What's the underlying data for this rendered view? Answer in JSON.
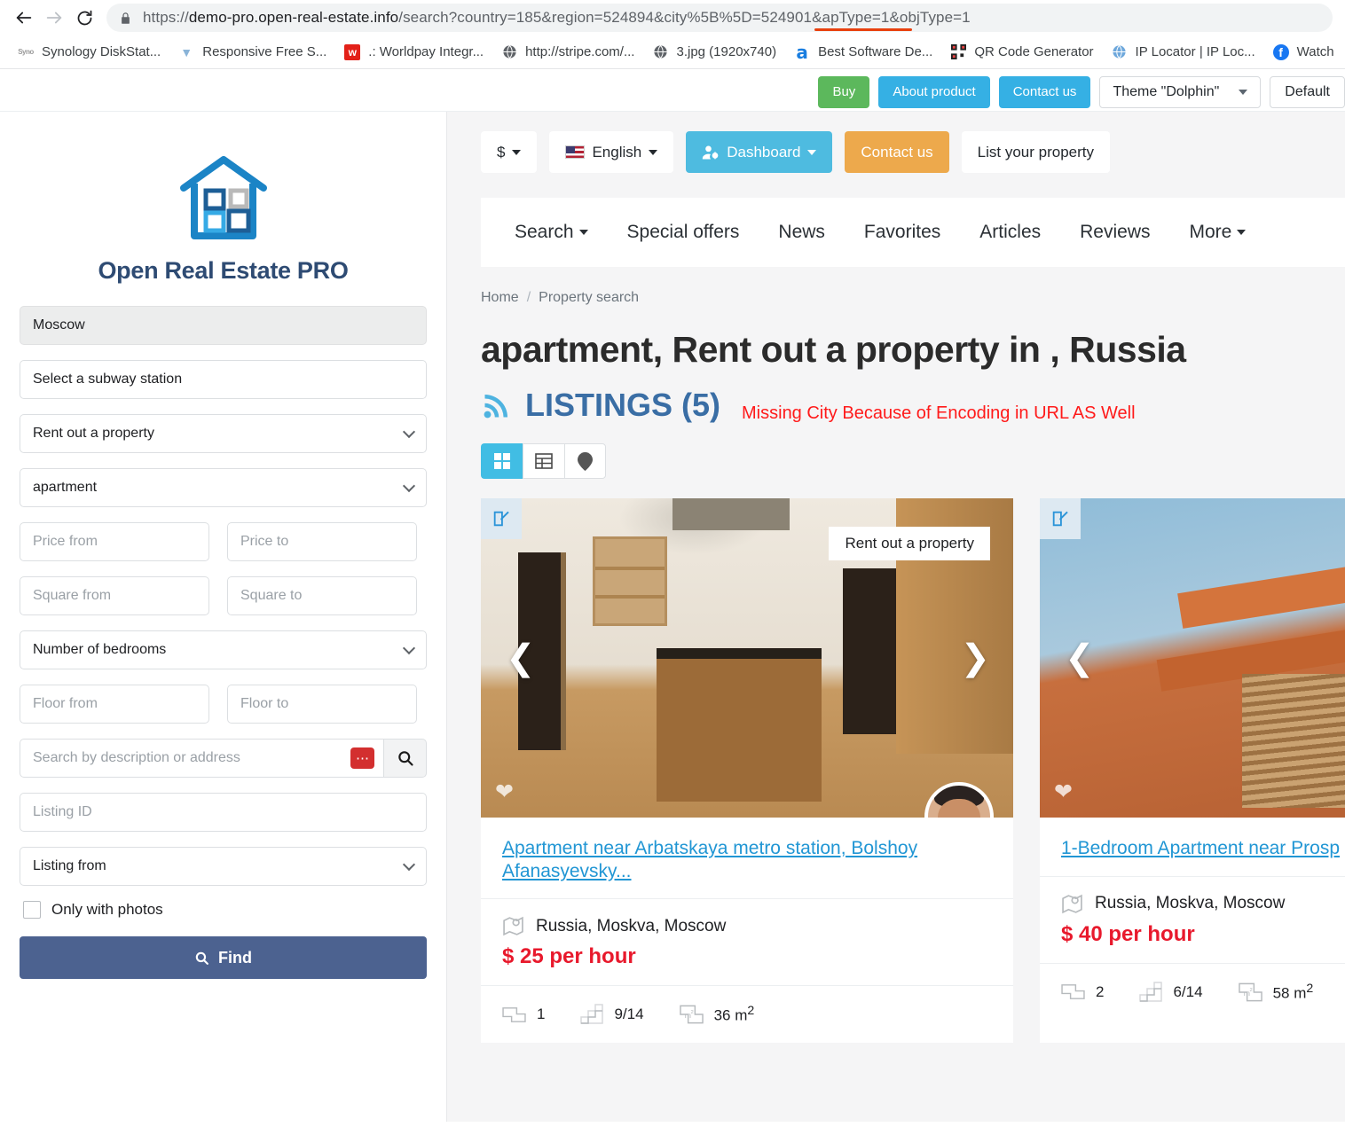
{
  "browser": {
    "url_prefix": "https://",
    "url_host": "demo-pro.open-real-estate.info",
    "url_path": "/search?country=185&region=524894&city%5B%5D=524901&apType=1&objType=1",
    "bookmarks": [
      {
        "label": "Synology DiskStat...",
        "icon": "syno-icon"
      },
      {
        "label": "Responsive Free S...",
        "icon": "responsive-icon"
      },
      {
        "label": ".: Worldpay Integr...",
        "icon": "worldpay-icon"
      },
      {
        "label": "http://stripe.com/...",
        "icon": "globe-icon"
      },
      {
        "label": "3.jpg (1920x740)",
        "icon": "globe-icon"
      },
      {
        "label": "Best Software De...",
        "icon": "amazon-icon"
      },
      {
        "label": "QR Code Generator",
        "icon": "qr-icon"
      },
      {
        "label": "IP Locator | IP Loc...",
        "icon": "globe-icon"
      },
      {
        "label": "Watch",
        "icon": "facebook-icon"
      }
    ]
  },
  "demo_bar": {
    "buy": "Buy",
    "about": "About product",
    "contact": "Contact us",
    "theme": "Theme \"Dolphin\"",
    "default": "Default"
  },
  "sidebar": {
    "brand": "Open Real Estate PRO",
    "fields": {
      "city": {
        "value": "Moscow",
        "type": "filled"
      },
      "subway": {
        "value": "Select a subway station",
        "type": "text"
      },
      "deal_type": {
        "value": "Rent out a property",
        "type": "select"
      },
      "object_type": {
        "value": "apartment",
        "type": "select"
      },
      "price_from": {
        "placeholder": "Price from"
      },
      "price_to": {
        "placeholder": "Price to"
      },
      "square_from": {
        "placeholder": "Square from"
      },
      "square_to": {
        "placeholder": "Square to"
      },
      "bedrooms": {
        "value": "Number of bedrooms",
        "type": "select"
      },
      "floor_from": {
        "placeholder": "Floor from"
      },
      "floor_to": {
        "placeholder": "Floor to"
      },
      "description": {
        "placeholder": "Search by description or address"
      },
      "listing_id": {
        "placeholder": "Listing ID"
      },
      "listing_from": {
        "value": "Listing from",
        "type": "select"
      }
    },
    "only_with_photos": "Only with photos",
    "find_button": "Find"
  },
  "header": {
    "currency": "$",
    "language": "English",
    "dashboard": "Dashboard",
    "contact_us": "Contact us",
    "list_property": "List your property"
  },
  "nav": [
    {
      "label": "Search",
      "caret": true
    },
    {
      "label": "Special offers",
      "caret": false
    },
    {
      "label": "News",
      "caret": false
    },
    {
      "label": "Favorites",
      "caret": false
    },
    {
      "label": "Articles",
      "caret": false
    },
    {
      "label": "Reviews",
      "caret": false
    },
    {
      "label": "More",
      "caret": true
    }
  ],
  "breadcrumb": {
    "home": "Home",
    "sep": "/",
    "current": "Property search"
  },
  "page": {
    "title": "apartment, Rent out a property in , Russia",
    "listings_heading": "LISTINGS (5)",
    "annotation": "Missing City Because of Encoding in URL AS Well"
  },
  "listings": [
    {
      "title": "Apartment near Arbatskaya metro station, Bolshoy Afanasyevsky...",
      "ribbon": "Rent out a property",
      "location": "Russia, Moskva, Moscow",
      "price": "$ 25 per hour",
      "rooms": "1",
      "floor": "9/14",
      "area": "36 m",
      "area_sup": "2"
    },
    {
      "title": "1-Bedroom Apartment near Prosp",
      "ribbon": "",
      "location": "Russia, Moskva, Moscow",
      "price": "$ 40 per hour",
      "rooms": "2",
      "floor": "6/14",
      "area": "58 m",
      "area_sup": "2"
    }
  ],
  "colors": {
    "brand_blue": "#2e4b73",
    "accent_cyan": "#41bde4",
    "price_red": "#e8192c",
    "annotation_red": "#ff1a1a",
    "find_button": "#4c6290",
    "link_blue": "#2196d4",
    "orange": "#eda94c",
    "green": "#5cb85c"
  }
}
